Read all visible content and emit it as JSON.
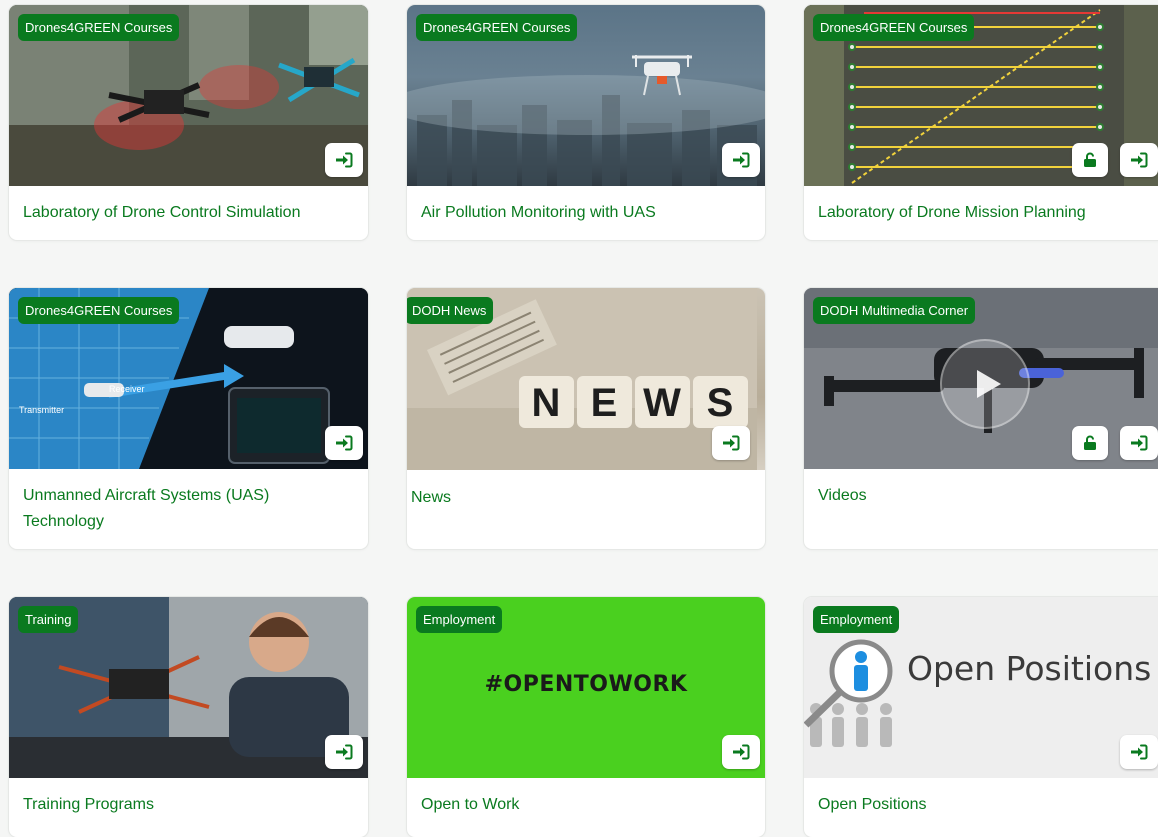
{
  "colors": {
    "brand_green": "#0a7a1f",
    "card_bg": "#ffffff",
    "page_bg": "#f5f6f5"
  },
  "icons": {
    "enter": "login-arrow-icon",
    "lock": "unlock-icon",
    "play": "play-icon"
  },
  "cards": [
    {
      "badge": "Drones4GREEN Courses",
      "title": "Laboratory of Drone Control Simulation"
    },
    {
      "badge": "Drones4GREEN Courses",
      "title": "Air Pollution Monitoring with UAS"
    },
    {
      "badge": "Drones4GREEN Courses",
      "title": "Laboratory of Drone Mission Planning"
    },
    {
      "badge": "Drones4GREEN Courses",
      "title": "Unmanned Aircraft Systems (UAS) Technology",
      "image_labels": {
        "transmitter": "Transmitter",
        "receiver": "Receiver"
      }
    },
    {
      "badge": "DODH News",
      "title": "News",
      "image_text": [
        "N",
        "E",
        "W",
        "S"
      ]
    },
    {
      "badge": "DODH Multimedia Corner",
      "title": "Videos"
    },
    {
      "badge": "Training",
      "title": "Training Programs"
    },
    {
      "badge": "Employment",
      "title": "Open to Work",
      "image_text": "#OPENTOWORK"
    },
    {
      "badge": "Employment",
      "title": "Open Positions",
      "image_text": "Open Positions"
    }
  ]
}
